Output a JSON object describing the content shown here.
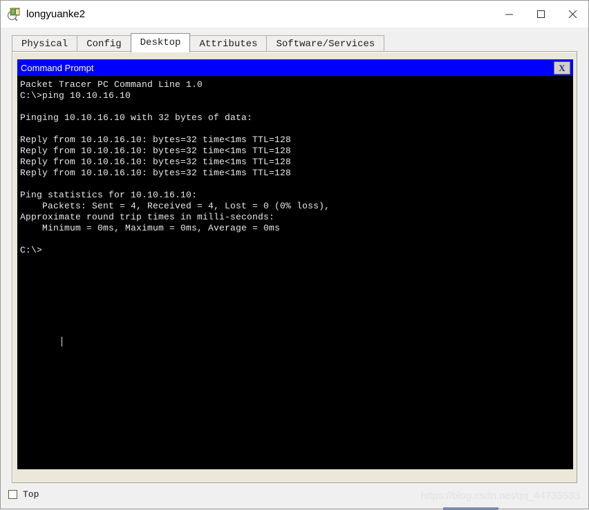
{
  "window": {
    "title": "longyuanke2",
    "icon": "packet-tracer-device-icon",
    "controls": {
      "minimize": "minimize-icon",
      "maximize": "maximize-icon",
      "close": "close-icon"
    }
  },
  "tabs": [
    {
      "label": "Physical",
      "active": false
    },
    {
      "label": "Config",
      "active": false
    },
    {
      "label": "Desktop",
      "active": true
    },
    {
      "label": "Attributes",
      "active": false
    },
    {
      "label": "Software/Services",
      "active": false
    }
  ],
  "command_prompt": {
    "title": "Command Prompt",
    "close_label": "X",
    "title_bar_color": "#0000FF",
    "terminal_bg": "#000000",
    "terminal_fg": "#E9E9E9",
    "output": "Packet Tracer PC Command Line 1.0\nC:\\>ping 10.10.16.10\n\nPinging 10.10.16.10 with 32 bytes of data:\n\nReply from 10.10.16.10: bytes=32 time<1ms TTL=128\nReply from 10.10.16.10: bytes=32 time<1ms TTL=128\nReply from 10.10.16.10: bytes=32 time<1ms TTL=128\nReply from 10.10.16.10: bytes=32 time<1ms TTL=128\n\nPing statistics for 10.10.16.10:\n    Packets: Sent = 4, Received = 4, Lost = 0 (0% loss),\nApproximate round trip times in milli-seconds:\n    Minimum = 0ms, Maximum = 0ms, Average = 0ms\n\nC:\\>"
  },
  "bottom": {
    "top_checkbox_label": "Top",
    "top_checkbox_checked": false,
    "watermark": "https://blog.csdn.net/qq_44735533"
  }
}
